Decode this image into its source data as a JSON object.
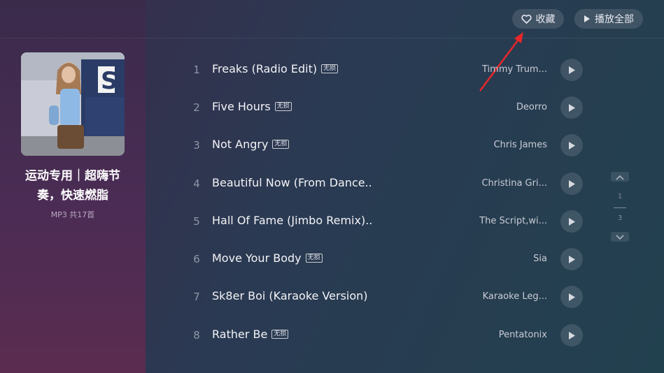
{
  "header": {
    "favorite_label": "收藏",
    "play_all_label": "播放全部"
  },
  "playlist": {
    "title": "运动专用｜超嗨节奏，快速燃脂",
    "meta": "MP3 共17首"
  },
  "tracks": [
    {
      "num": "1",
      "title": "Freaks (Radio Edit)",
      "badge": "无损",
      "artist": "Timmy Trum..."
    },
    {
      "num": "2",
      "title": "Five Hours",
      "badge": "无损",
      "artist": "Deorro"
    },
    {
      "num": "3",
      "title": "Not Angry",
      "badge": "无损",
      "artist": "Chris James"
    },
    {
      "num": "4",
      "title": "Beautiful Now (From Dance..",
      "badge": "",
      "artist": "Christina Gri..."
    },
    {
      "num": "5",
      "title": "Hall Of Fame (Jimbo Remix)..",
      "badge": "",
      "artist": "The Script,wi..."
    },
    {
      "num": "6",
      "title": "Move Your Body",
      "badge": "无损",
      "artist": "Sia"
    },
    {
      "num": "7",
      "title": "Sk8er Boi (Karaoke Version)",
      "badge": "",
      "artist": "Karaoke Leg..."
    },
    {
      "num": "8",
      "title": "Rather Be",
      "badge": "无损",
      "artist": "Pentatonix"
    }
  ],
  "pager": {
    "current": "1",
    "total": "3"
  },
  "icons": {
    "favorite": "heart-icon",
    "play_all": "play-icon",
    "track_play": "play-icon",
    "page_up": "chevron-up-icon",
    "page_down": "chevron-down-icon"
  },
  "colors": {
    "annotation_arrow": "#e8262a",
    "badge_border": "#ffffff"
  }
}
